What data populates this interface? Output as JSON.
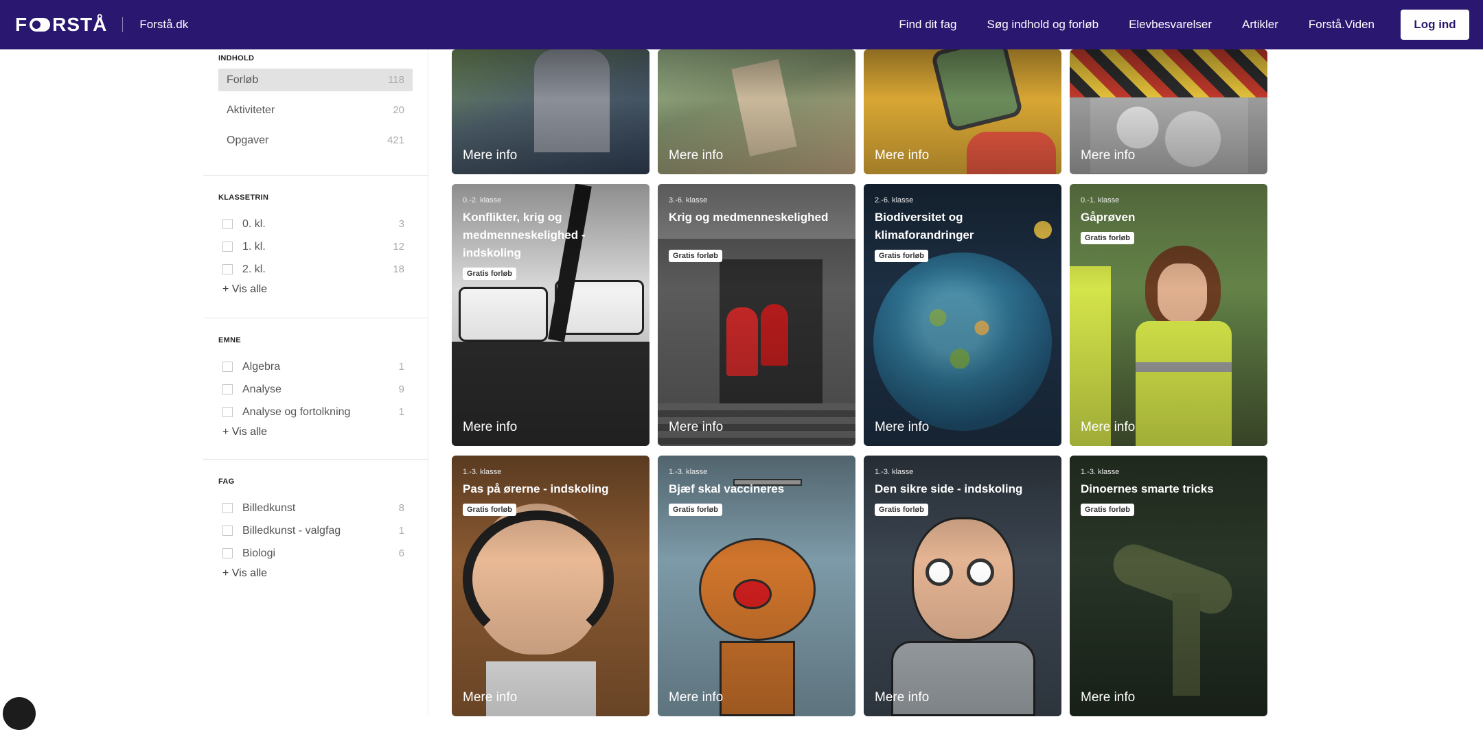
{
  "header": {
    "logo": "FORSTÅ",
    "site": "Forstå.dk",
    "nav": [
      "Find dit fag",
      "Søg indhold og forløb",
      "Elevbesvarelser",
      "Artikler",
      "Forstå.Viden"
    ],
    "login": "Log ind"
  },
  "sidebar": {
    "indhold": {
      "title": "INDHOLD",
      "items": [
        {
          "label": "Forløb",
          "count": "118"
        },
        {
          "label": "Aktiviteter",
          "count": "20"
        },
        {
          "label": "Opgaver",
          "count": "421"
        }
      ]
    },
    "klassetrin": {
      "title": "KLASSETRIN",
      "items": [
        {
          "label": "0. kl.",
          "count": "3"
        },
        {
          "label": "1. kl.",
          "count": "12"
        },
        {
          "label": "2. kl.",
          "count": "18"
        }
      ],
      "more": "+ Vis alle"
    },
    "emne": {
      "title": "EMNE",
      "items": [
        {
          "label": "Algebra",
          "count": "1"
        },
        {
          "label": "Analyse",
          "count": "9"
        },
        {
          "label": "Analyse og fortolkning",
          "count": "1"
        }
      ],
      "more": "+ Vis alle"
    },
    "fag": {
      "title": "FAG",
      "items": [
        {
          "label": "Billedkunst",
          "count": "8"
        },
        {
          "label": "Billedkunst - valgfag",
          "count": "1"
        },
        {
          "label": "Biologi",
          "count": "6"
        }
      ],
      "more": "+ Vis alle"
    }
  },
  "cards": {
    "more_info": "Mere info",
    "badge": "Gratis forløb",
    "row2": [
      {
        "level": "0.-2. klasse",
        "title": "Konflikter, krig og medmenneskelighed - indskoling"
      },
      {
        "level": "3.-6. klasse",
        "title": "Krig og medmenneskelighed"
      },
      {
        "level": "2.-6. klasse",
        "title": "Biodiversitet og klimaforandringer"
      },
      {
        "level": "0.-1. klasse",
        "title": "Gåprøven"
      }
    ],
    "row3": [
      {
        "level": "1.-3. klasse",
        "title": "Pas på ørerne - indskoling"
      },
      {
        "level": "1.-3. klasse",
        "title": "Bjæf skal vaccineres"
      },
      {
        "level": "1.-3. klasse",
        "title": "Den sikre side - indskoling"
      },
      {
        "level": "1.-3. klasse",
        "title": "Dinoernes smarte tricks"
      }
    ]
  },
  "colors": {
    "header_bg": "#2a1770",
    "login_text": "#2a1770"
  }
}
